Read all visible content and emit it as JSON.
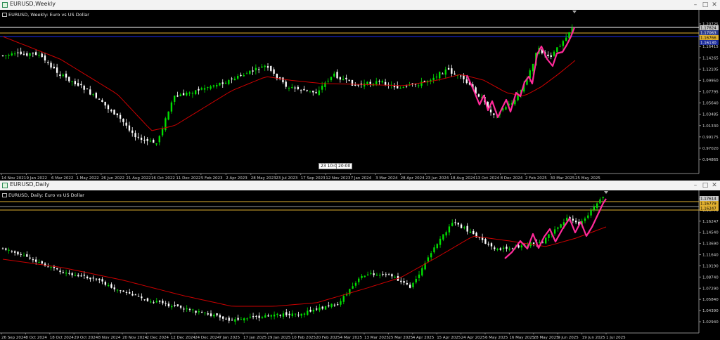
{
  "weekly": {
    "title": "EURUSD,Weekly",
    "chart_label": "EURUSD, Weekly:  Euro vs US Dollar",
    "tooltip": "23",
    "tooltip_time": "10:00",
    "tooltip_right": "20:00",
    "y_ticks": [
      "1.20725",
      "1.18570",
      "1.16415",
      "1.14265",
      "1.12105",
      "1.09950",
      "1.07795",
      "1.05640",
      "1.03485",
      "1.01330",
      "0.99175",
      "0.97020",
      "0.94865"
    ],
    "price_boxes": [
      {
        "text": "1.17824",
        "color": "#c8c8c8",
        "fg": "#000"
      },
      {
        "text": "1.17063",
        "color": "#2a3a8a",
        "fg": "#fff"
      },
      {
        "text": "1.16766",
        "color": "#e0b030",
        "fg": "#000"
      },
      {
        "text": "1.16130",
        "color": "#1a2a9a",
        "fg": "#fff"
      }
    ],
    "x_ticks": [
      "14 Nov 2021",
      "9 Jan 2022",
      "6 Mar 2022",
      "1 May 2022",
      "26 Jun 2022",
      "21 Aug 2022",
      "16 Oct 2022",
      "11 Dec 2022",
      "5 Feb 2023",
      "2 Apr 2023",
      "28 May 2023",
      "23 Jul 2023",
      "17 Sep 2023",
      "12 Nov 2023",
      "7 Jan 2024",
      "3 Mar 2024",
      "28 Apr 2024",
      "23 Jun 2024",
      "18 Aug 2024",
      "13 Oct 2024",
      "8 Dec 2024",
      "2 Feb 2025",
      "30 Mar 2025",
      "25 May 2025"
    ]
  },
  "daily": {
    "title": "EURUSD,Daily",
    "chart_label": "EURUSD, Daily:  Euro vs US Dollar",
    "y_ticks": [
      "1.17614",
      "1.16779",
      "1.16247",
      "1.14540",
      "1.13690",
      "1.11640",
      "1.10190",
      "1.08740",
      "1.07290",
      "1.05840",
      "1.04390",
      "1.02940"
    ],
    "price_boxes": [
      {
        "text": "1.17614",
        "color": "#c8c8c8",
        "fg": "#000"
      },
      {
        "text": "1.16779",
        "color": "#e0b030",
        "fg": "#000"
      },
      {
        "text": "1.16247",
        "color": "#e0b030",
        "fg": "#000"
      }
    ],
    "x_ticks": [
      "26 Sep 2024",
      "8 Oct 2024",
      "18 Oct 2024",
      "29 Oct 2024",
      "8 Nov 2024",
      "20 Nov 2024",
      "2 Dec 2024",
      "12 Dec 2024",
      "24 Dec 2024",
      "7 Jan 2025",
      "17 Jan 2025",
      "29 Jan 2025",
      "10 Feb 2025",
      "20 Feb 2025",
      "4 Mar 2025",
      "13 Mar 2025",
      "25 Mar 2025",
      "4 Apr 2025",
      "15 Apr 2025",
      "24 Apr 2025",
      "6 May 2025",
      "16 May 2025",
      "28 May 2025",
      "9 Jun 2025",
      "19 Jun 2025",
      "1 Jul 2025"
    ]
  },
  "window_controls": {
    "minimize": "–",
    "maximize": "□",
    "close": "✕"
  },
  "colors": {
    "bull": "#00e000",
    "bear": "#ffffff",
    "ma": "#cc0000",
    "wave": "#ff2a9a",
    "bg": "#000000",
    "axis": "#cfcfcf"
  }
}
